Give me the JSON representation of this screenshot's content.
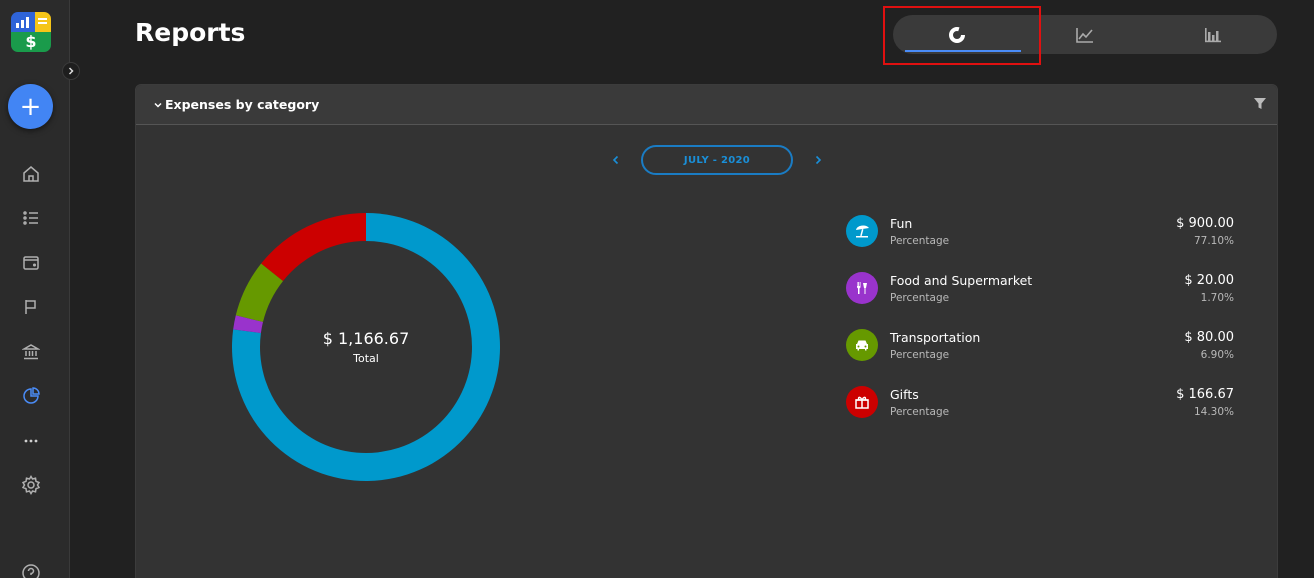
{
  "header": {
    "title": "Reports"
  },
  "view_toggle": {
    "items": [
      {
        "icon": "donut-chart-icon",
        "active": true
      },
      {
        "icon": "line-chart-icon",
        "active": false
      },
      {
        "icon": "bar-chart-icon",
        "active": false
      }
    ],
    "active_color": "#4a8cf7"
  },
  "sidebar": {
    "add_label": "+",
    "items": [
      {
        "icon": "home-icon"
      },
      {
        "icon": "list-icon"
      },
      {
        "icon": "wallet-icon"
      },
      {
        "icon": "flag-icon"
      },
      {
        "icon": "bank-icon"
      },
      {
        "icon": "pie-chart-icon",
        "active": true
      },
      {
        "icon": "more-icon"
      },
      {
        "icon": "settings-icon"
      },
      {
        "icon": "help-icon"
      }
    ],
    "active_color": "#4a8cf7"
  },
  "card": {
    "title": "Expenses by category",
    "period": "JULY - 2020"
  },
  "chart_data": {
    "type": "pie",
    "title": "Expenses by category",
    "total_label": "$ 1,166.67",
    "total_caption": "Total",
    "series": [
      {
        "name": "Fun",
        "amount": "$ 900.00",
        "percent_label": "77.10%",
        "value": 77.1,
        "color": "#0099cc",
        "icon": "beach-umbrella-icon"
      },
      {
        "name": "Food and Supermarket",
        "amount": "$ 20.00",
        "percent_label": "1.70%",
        "value": 1.7,
        "color": "#9933cc",
        "icon": "food-icon"
      },
      {
        "name": "Transportation",
        "amount": "$ 80.00",
        "percent_label": "6.90%",
        "value": 6.9,
        "color": "#669900",
        "icon": "car-icon"
      },
      {
        "name": "Gifts",
        "amount": "$ 166.67",
        "percent_label": "14.30%",
        "value": 14.3,
        "color": "#cc0000",
        "icon": "gift-icon"
      }
    ],
    "sub_label": "Percentage"
  }
}
